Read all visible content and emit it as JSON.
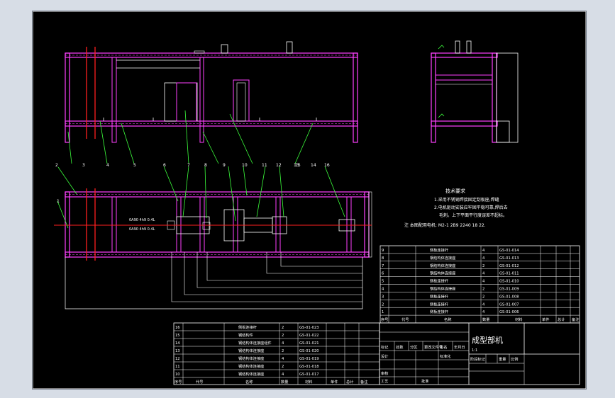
{
  "notes": {
    "heading": "技术要求",
    "line1": "1.采用不锈钢焊接固定刮板座,焊缝",
    "line2": "2.电机驱动安装应牢固平稳可靠,焊后去",
    "line3": "毛刺。上下平面平行度误差不超标。",
    "remark_line": "注  本图配用电机: M2-1 2B9 2240 18 22.",
    "inner_text1": "0A90 4h9 0.4L",
    "inner_text2": "0A90 4h9 0.4L"
  },
  "balloons": [
    "1",
    "2",
    "3",
    "4",
    "5",
    "6",
    "7",
    "8",
    "9",
    "10",
    "11",
    "12",
    "13",
    "14",
    "15",
    "16"
  ],
  "title_block": {
    "title": "成型部机",
    "scale_label": "1:1",
    "header_row": [
      "标记",
      "处数",
      "分区",
      "更改文件号",
      "签名",
      "年月日"
    ],
    "left_header": [
      "序号",
      "代号",
      "名称",
      "数量",
      "材料",
      "单件",
      "总计",
      "备注"
    ],
    "right_header": [
      "序号",
      "代号",
      "名称",
      "数量",
      "材料",
      "单件",
      "总计",
      "备注"
    ],
    "design_label": "设计",
    "check_label": "审核",
    "process_label": "工艺",
    "approve_label": "批准",
    "stage_label": "阶段标记",
    "weight_label": "重量",
    "ratio_label": "比例",
    "std_label": "标准化"
  },
  "parts_right": [
    {
      "no": "9",
      "name": "侧板连接杆",
      "qty": "4",
      "code": "GS-01-014"
    },
    {
      "no": "8",
      "name": "钢结构体连接座",
      "qty": "4",
      "code": "GS-01-013"
    },
    {
      "no": "7",
      "name": "钢结构体连接座",
      "qty": "2",
      "code": "GS-01-012"
    },
    {
      "no": "6",
      "name": "钢结构体连接座",
      "qty": "4",
      "code": "GS-01-011"
    },
    {
      "no": "5",
      "name": "侧板连接杆",
      "qty": "4",
      "code": "GS-01-010"
    },
    {
      "no": "4",
      "name": "钢结构体连接座",
      "qty": "2",
      "code": "GS-01-009"
    },
    {
      "no": "3",
      "name": "侧板连接杆",
      "qty": "2",
      "code": "GS-01-008"
    },
    {
      "no": "2",
      "name": "侧板连接杆",
      "qty": "4",
      "code": "GS-01-007"
    },
    {
      "no": "1",
      "name": "侧板连接杆",
      "qty": "4",
      "code": "GS-01-006"
    }
  ],
  "parts_left": [
    {
      "no": "16",
      "name": "侧板连接杆",
      "qty": "2",
      "code": "GS-01-023"
    },
    {
      "no": "15",
      "name": "钢结构件",
      "qty": "2",
      "code": "GS-01-022"
    },
    {
      "no": "14",
      "name": "钢结构体连接座组件",
      "qty": "4",
      "code": "GS-01-021"
    },
    {
      "no": "13",
      "name": "钢结构体连接座",
      "qty": "2",
      "code": "GS-01-020"
    },
    {
      "no": "12",
      "name": "钢结构体连接座",
      "qty": "4",
      "code": "GS-01-019"
    },
    {
      "no": "11",
      "name": "钢结构体连接座",
      "qty": "2",
      "code": "GS-01-018"
    },
    {
      "no": "10",
      "name": "钢结构体连接座",
      "qty": "4",
      "code": "GS-01-017"
    }
  ]
}
